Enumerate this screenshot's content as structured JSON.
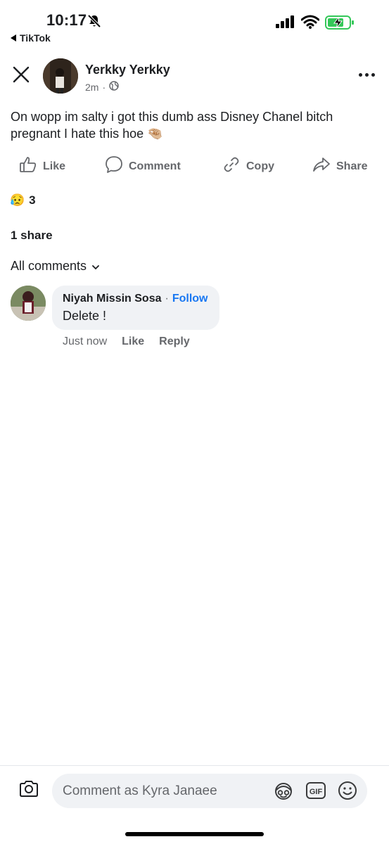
{
  "status_bar": {
    "time": "10:17",
    "back_app": "TikTok",
    "icons": [
      "bell-muted-icon",
      "signal-icon",
      "wifi-icon",
      "battery-charging-icon"
    ]
  },
  "post": {
    "author": "Yerkky Yerkky",
    "time": "2m",
    "privacy": "globe-icon",
    "text": "On wopp im salty i got this dumb ass Disney Chanel bitch pregnant I hate this hoe 🤏🏼"
  },
  "actions": {
    "like": "Like",
    "comment": "Comment",
    "copy": "Copy",
    "share": "Share"
  },
  "reactions": {
    "emoji": "😥",
    "count": "3"
  },
  "shares_text": "1 share",
  "comments_filter": "All comments",
  "comments": [
    {
      "name": "Niyah Missin Sosa",
      "separator": "·",
      "follow": "Follow",
      "text": "Delete !",
      "time": "Just now",
      "like": "Like",
      "reply": "Reply"
    }
  ],
  "composer": {
    "placeholder": "Comment as Kyra Janaee",
    "gif": "GIF"
  },
  "colors": {
    "accent": "#1877f2",
    "battery": "#34c759",
    "secondary_text": "#65676b",
    "bubble": "#f0f2f5"
  }
}
